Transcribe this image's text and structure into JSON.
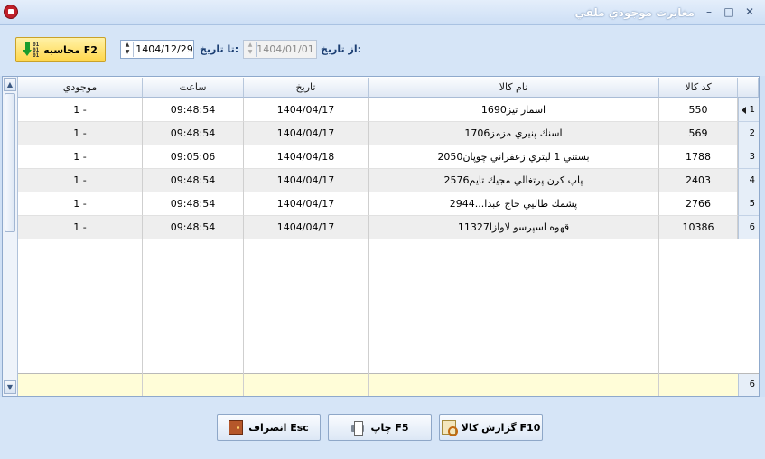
{
  "window": {
    "title": "مغايرت موجودي ملفي",
    "minimize": "–",
    "maximize": "□",
    "close": "✕"
  },
  "toolbar": {
    "calc_label": "محاسبه F2",
    "calc_icon": "download-arrow-icon",
    "calc_digits": "01\n01\n01",
    "to_date_label": "تا تاريخ:",
    "to_date_value": "1404/12/29",
    "from_date_label": "از تاريخ:",
    "from_date_value": "1404/01/01",
    "spin": "▲\n▼"
  },
  "grid": {
    "columns": [
      "موجودي",
      "ساعت",
      "تاريخ",
      "نام كالا",
      "كد كالا"
    ],
    "rows": [
      {
        "num": "1",
        "stock": "1 -",
        "time": "09:48:54",
        "date": "1404/04/17",
        "name": "اسمار تيز1690",
        "code": "550"
      },
      {
        "num": "2",
        "stock": "1 -",
        "time": "09:48:54",
        "date": "1404/04/17",
        "name": "اسنك پنيري مزمز1706",
        "code": "569"
      },
      {
        "num": "3",
        "stock": "1 -",
        "time": "09:05:06",
        "date": "1404/04/18",
        "name": "بستني 1 ليتري زعفراني چوپان2050",
        "code": "1788"
      },
      {
        "num": "4",
        "stock": "1 -",
        "time": "09:48:54",
        "date": "1404/04/17",
        "name": "پاپ كرن پرتغالي مجيك تايم2576",
        "code": "2403"
      },
      {
        "num": "5",
        "stock": "1 -",
        "time": "09:48:54",
        "date": "1404/04/17",
        "name": "پشمك طاليي حاج عبدا...2944",
        "code": "2766"
      },
      {
        "num": "6",
        "stock": "1 -",
        "time": "09:48:54",
        "date": "1404/04/17",
        "name": "قهوه اسپرسو لاوازا11327",
        "code": "10386"
      }
    ],
    "footer_count": "6",
    "scroll_up": "▲",
    "scroll_down": "▼"
  },
  "buttons": {
    "cancel_label": "انصراف Esc",
    "print_label": "چاپ F5",
    "report_label": "گزارش كالا F10"
  }
}
